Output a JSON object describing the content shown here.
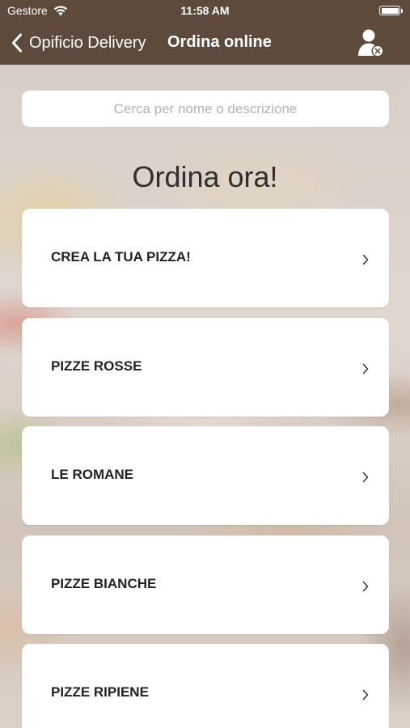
{
  "status_bar": {
    "carrier": "Gestore",
    "time": "11:58 AM",
    "battery_level": 1.0
  },
  "nav": {
    "back_label": "Opificio Delivery",
    "title": "Ordina online",
    "user_icon": "user-remove-icon"
  },
  "search": {
    "placeholder": "Cerca per nome o descrizione",
    "value": ""
  },
  "heading": "Ordina ora!",
  "categories": [
    {
      "label": "CREA LA TUA PIZZA!"
    },
    {
      "label": "PIZZE ROSSE"
    },
    {
      "label": "LE ROMANE"
    },
    {
      "label": "PIZZE BIANCHE"
    },
    {
      "label": "PIZZE RIPIENE"
    }
  ],
  "colors": {
    "header": "#5d4a3a",
    "card": "#ffffff",
    "text": "#222222"
  }
}
